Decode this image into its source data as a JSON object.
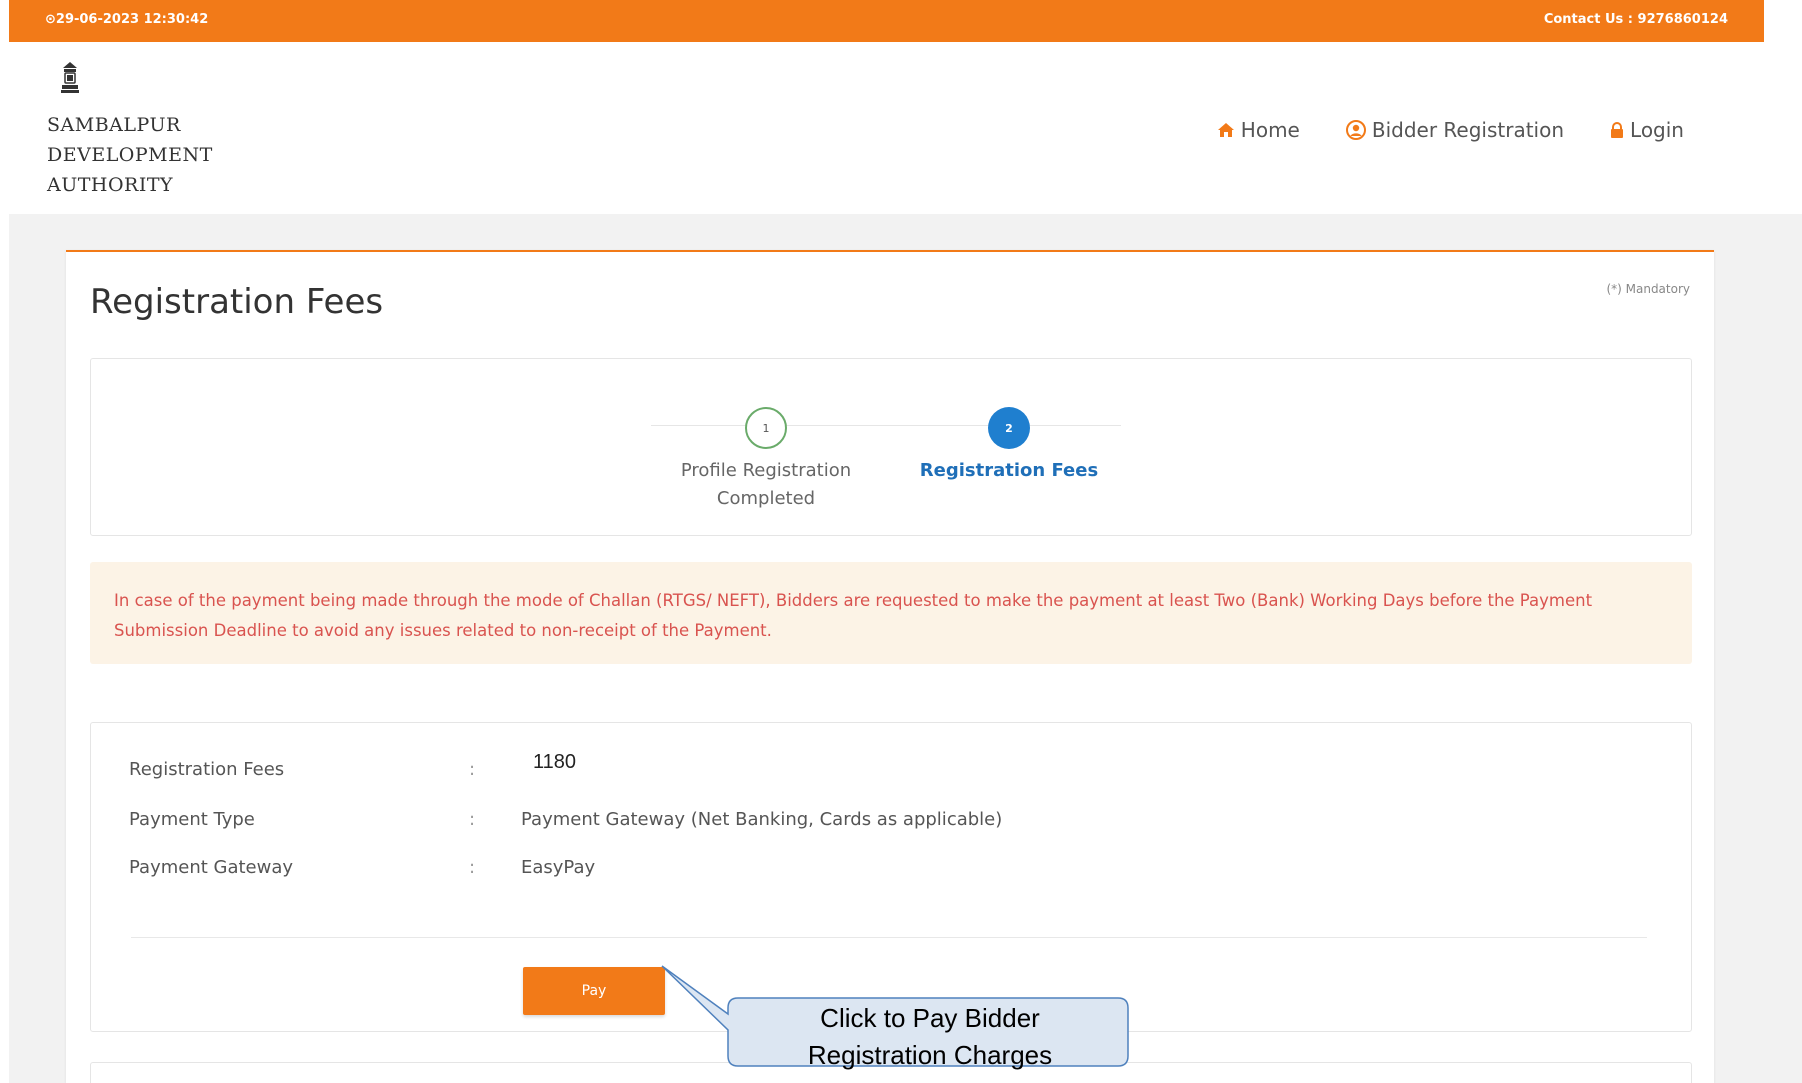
{
  "topbar": {
    "datetime": "⊙29-06-2023 12:30:42",
    "contact": "Contact Us : 9276860124"
  },
  "logo": {
    "line1": "SAMBALPUR",
    "line2": "DEVELOPMENT",
    "line3": "AUTHORITY"
  },
  "nav": {
    "home": "Home",
    "bidder_registration": "Bidder Registration",
    "login": "Login"
  },
  "page": {
    "title": "Registration Fees",
    "mandatory": "(*) Mandatory"
  },
  "stepper": {
    "step1": {
      "number": "1",
      "label_line1": "Profile Registration",
      "label_line2": "Completed"
    },
    "step2": {
      "number": "2",
      "label_line1": "Registration Fees"
    }
  },
  "notice": {
    "text": "In case of the payment being made through the mode of Challan (RTGS/ NEFT), Bidders are requested to make the payment at least Two (Bank) Working Days before the Payment Submission Deadline to avoid any issues related to non-receipt of the Payment."
  },
  "details": {
    "registration_fees": {
      "label": "Registration Fees",
      "colon": ":",
      "value": "1180"
    },
    "payment_type": {
      "label": "Payment Type",
      "colon": ":",
      "value": "Payment Gateway (Net Banking, Cards as applicable)"
    },
    "payment_gateway": {
      "label": "Payment Gateway",
      "colon": ":",
      "value": "EasyPay"
    },
    "pay_button": "Pay"
  },
  "callout": {
    "line1": "Click to Pay Bidder",
    "line2": "Registration Charges"
  },
  "colors": {
    "accent": "#f27a18",
    "step_active": "#1f7fcf",
    "step_done": "#6aab6a",
    "notice_text": "#d9534f",
    "callout_fill": "#dce6f2",
    "callout_border": "#4f81bd"
  }
}
